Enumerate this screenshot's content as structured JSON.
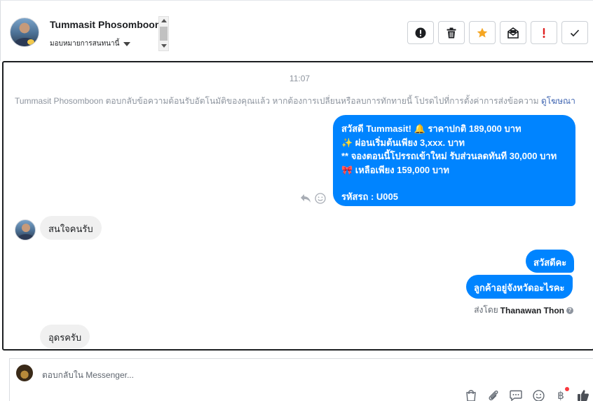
{
  "header": {
    "contact_name": "Tummasit Phosomboon",
    "assign_label": "มอบหมายการสนทนานี้",
    "toolbar": [
      {
        "icon": "alert-circle-icon",
        "color": "#1c1e21"
      },
      {
        "icon": "trash-icon",
        "color": "#1c1e21"
      },
      {
        "icon": "star-icon",
        "color": "#f5a623"
      },
      {
        "icon": "mark-unread-icon",
        "color": "#1c1e21"
      },
      {
        "icon": "exclamation-icon",
        "color": "#e02020"
      },
      {
        "icon": "checkmark-icon",
        "color": "#1c1e21"
      }
    ]
  },
  "conversation": {
    "timestamp": "11:07",
    "notice_text": "Tummasit Phosomboon ตอบกลับข้อความต้อนรับอัตโนมัติของคุณแล้ว หากต้องการเปลี่ยนหรือลบการทักทายนี้ โปรดไปที่การตั้งค่าการส่งข้อความ",
    "notice_link": "ดูโฆษณา",
    "main_message": {
      "line1": "สวัสดี Tummasit! 🔔 ราคาปกติ  189,000 บาท",
      "line2": "✨  ผ่อนเริ่มต้นเพียง 3,xxx. บาท",
      "line3": "** จองตอนนี้โปรรถเข้าใหม่ รับส่วนลดทันที 30,000 บาท",
      "line4": "🎀  เหลือเพียง 159,000 บาท",
      "line5": " รหัสรถ : U005"
    },
    "incoming_1": "สนใจคนรับ",
    "outgoing_2": "สวัสดีคะ",
    "outgoing_3": "ลูกค้าอยู่จังหวัดอะไรคะ",
    "sent_by_label": "ส่งโดย",
    "sent_by_name": "Thanawan Thon",
    "incoming_2": "อุดรครับ"
  },
  "composer": {
    "placeholder": "ตอบกลับใน Messenger...",
    "tools": [
      "shopping-bag-icon",
      "paperclip-icon",
      "chat-template-icon",
      "emoji-icon",
      "baht-payment-icon",
      "thumbs-up-icon"
    ],
    "accent_color": "#0084ff"
  }
}
